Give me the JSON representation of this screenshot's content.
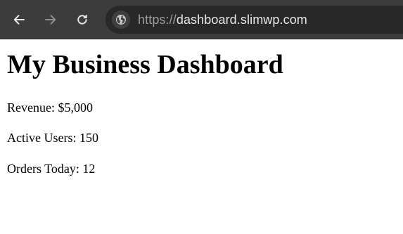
{
  "browser": {
    "url_scheme": "https://",
    "url_host": "dashboard.slimwp.com",
    "icons": {
      "back": "arrow-left-icon",
      "forward": "arrow-right-icon",
      "reload": "reload-icon",
      "site_info": "globe-icon"
    },
    "colors": {
      "toolbar": "#3c3c3c",
      "omnibox": "#282828"
    }
  },
  "page": {
    "title": "My Business Dashboard",
    "stats": [
      "Revenue: $5,000",
      "Active Users: 150",
      "Orders Today: 12"
    ]
  }
}
